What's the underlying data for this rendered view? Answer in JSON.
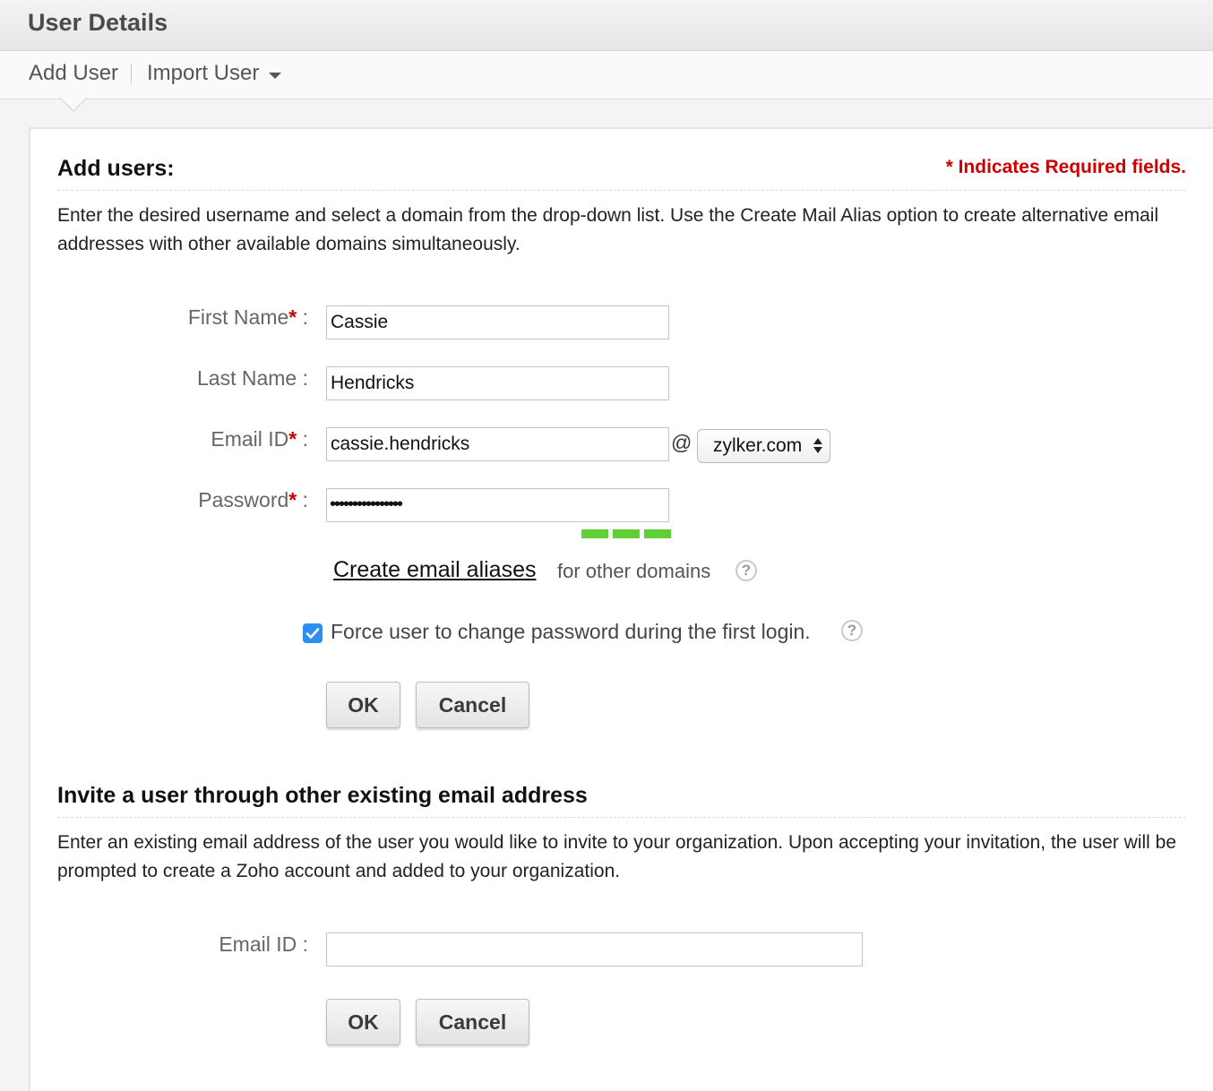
{
  "header": {
    "title": "User Details"
  },
  "subnav": {
    "add_user": "Add User",
    "import_user": "Import User"
  },
  "add_section": {
    "heading": "Add users:",
    "required_note": "* Indicates Required fields.",
    "description": "Enter the desired username and select a domain from the drop-down list. Use the Create Mail Alias option to create alternative email addresses with other available domains simultaneously.",
    "first_name": {
      "label": "First Name",
      "value": "Cassie"
    },
    "last_name": {
      "label": "Last Name :",
      "value": "Hendricks"
    },
    "email": {
      "label": "Email ID",
      "value": "cassie.hendricks",
      "at": "@",
      "domain": "zylker.com"
    },
    "password": {
      "label": "Password",
      "masked_value": "••••••••••••••••",
      "strength_segments": 3
    },
    "alias_link": "Create email aliases",
    "alias_suffix": "for other domains",
    "force_change": {
      "checked": true,
      "label": "Force user to change password during the first login."
    },
    "ok": "OK",
    "cancel": "Cancel"
  },
  "invite_section": {
    "heading": "Invite a user through other existing email address",
    "description": "Enter an existing email address of the user you would like to invite to your organization. Upon accepting your invitation, the user will be prompted to create a Zoho account and added to your organization.",
    "email": {
      "label": "Email ID :",
      "value": ""
    },
    "ok": "OK",
    "cancel": "Cancel"
  },
  "colors": {
    "required": "#cc0000",
    "strength": "#5fcf34",
    "checkbox": "#2f8ff0"
  },
  "icons": {
    "dropdown": "caret-down-icon",
    "help": "help-icon",
    "select": "select-arrows-icon",
    "check": "check-icon"
  }
}
